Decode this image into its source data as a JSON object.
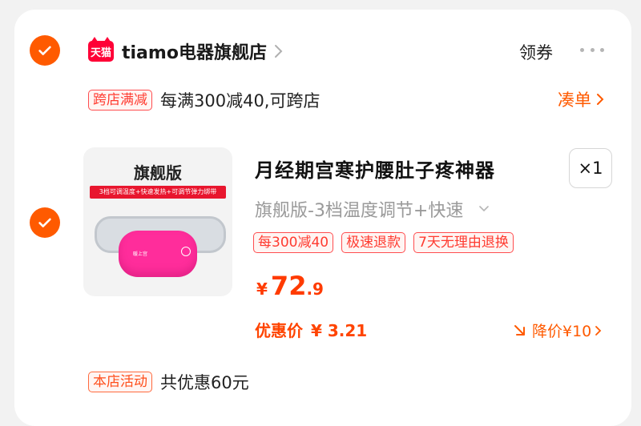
{
  "colors": {
    "accent": "#ff5a00",
    "price": "#ff3b00",
    "tag_border": "#ff4d4f",
    "tmall_red": "#ff0036"
  },
  "store": {
    "logo_text": "天猫",
    "name": "tiamo电器旗舰店",
    "coupon_label": "领券",
    "more_icon": "more-dots-icon"
  },
  "promo": {
    "tag": "跨店满减",
    "text": "每满300减40,可跨店",
    "combine_label": "凑单"
  },
  "item": {
    "image": {
      "title": "旗舰版",
      "band_text": "3档可调温度+快速发热+可调节弹力绑带",
      "pad_logo": "暖上宫"
    },
    "title": "月经期宫寒护腰肚子疼神器",
    "quantity": "×1",
    "spec": "旗舰版-3档温度调节+快速",
    "tags": [
      "每300减40",
      "极速退款",
      "7天无理由退换"
    ],
    "price": {
      "symbol": "¥",
      "integer": "72",
      "decimal": ".9"
    },
    "promo_price_label": "优惠价",
    "promo_price_value": "¥ 3.21",
    "price_drop": "降价¥10"
  },
  "store_activity": {
    "tag": "本店活动",
    "text": "共优惠60元"
  }
}
